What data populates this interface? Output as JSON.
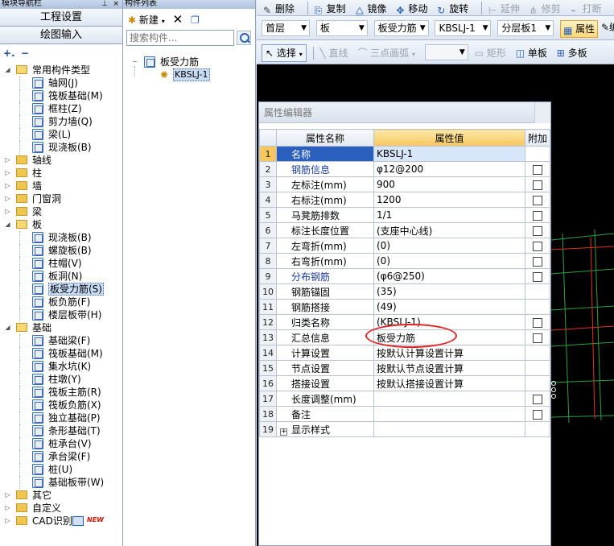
{
  "nav": {
    "title": "模块导航栏",
    "engineering_settings": "工程设置",
    "drawing_input": "绘图输入",
    "tree": [
      {
        "label": "常用构件类型",
        "level": 0,
        "open": true
      },
      {
        "label": "轴网(J)",
        "level": 1
      },
      {
        "label": "筏板基础(M)",
        "level": 1
      },
      {
        "label": "框柱(Z)",
        "level": 1
      },
      {
        "label": "剪力墙(Q)",
        "level": 1
      },
      {
        "label": "梁(L)",
        "level": 1
      },
      {
        "label": "现浇板(B)",
        "level": 1
      },
      {
        "label": "轴线",
        "level": 0
      },
      {
        "label": "柱",
        "level": 0
      },
      {
        "label": "墙",
        "level": 0
      },
      {
        "label": "门窗洞",
        "level": 0
      },
      {
        "label": "梁",
        "level": 0
      },
      {
        "label": "板",
        "level": 0,
        "open": true
      },
      {
        "label": "现浇板(B)",
        "level": 1
      },
      {
        "label": "螺旋板(B)",
        "level": 1
      },
      {
        "label": "柱帽(V)",
        "level": 1
      },
      {
        "label": "板洞(N)",
        "level": 1
      },
      {
        "label": "板受力筋(S)",
        "level": 1,
        "selected": true
      },
      {
        "label": "板负筋(F)",
        "level": 1
      },
      {
        "label": "楼层板带(H)",
        "level": 1
      },
      {
        "label": "基础",
        "level": 0,
        "open": true
      },
      {
        "label": "基础梁(F)",
        "level": 1
      },
      {
        "label": "筏板基础(M)",
        "level": 1
      },
      {
        "label": "集水坑(K)",
        "level": 1
      },
      {
        "label": "柱墩(Y)",
        "level": 1
      },
      {
        "label": "筏板主筋(R)",
        "level": 1
      },
      {
        "label": "筏板负筋(X)",
        "level": 1
      },
      {
        "label": "独立基础(P)",
        "level": 1
      },
      {
        "label": "条形基础(T)",
        "level": 1
      },
      {
        "label": "桩承台(V)",
        "level": 1
      },
      {
        "label": "承台梁(F)",
        "level": 1
      },
      {
        "label": "桩(U)",
        "level": 1
      },
      {
        "label": "基础板带(W)",
        "level": 1
      },
      {
        "label": "其它",
        "level": 0
      },
      {
        "label": "自定义",
        "level": 0
      },
      {
        "label": "CAD识别",
        "level": 0,
        "badge": "NEW"
      }
    ]
  },
  "list": {
    "title": "构件列表",
    "new_label": "新建",
    "search_placeholder": "搜索构件...",
    "group": "板受力筋",
    "item": "KBSLJ-1"
  },
  "toolbar1": {
    "delete": "删除",
    "copy": "复制",
    "mirror": "镜像",
    "move": "移动",
    "rotate": "旋转",
    "extend": "延伸",
    "trim": "修剪",
    "break": "打断"
  },
  "toolbar2": {
    "floor": "首层",
    "type": "板",
    "subtype": "板受力筋",
    "component": "KBSLJ-1",
    "layer": "分层板1",
    "property": "属性",
    "edit": "编"
  },
  "toolbar3": {
    "select": "选择",
    "line": "直线",
    "arc": "三点画弧",
    "rect": "矩形",
    "single_board": "单板",
    "multi_board": "多板"
  },
  "prop_editor": {
    "title": "属性编辑器",
    "col_name": "属性名称",
    "col_value": "属性值",
    "col_extra": "附加",
    "rows": [
      {
        "no": "1",
        "name": "名称",
        "value": "KBSLJ-1",
        "check": false
      },
      {
        "no": "2",
        "name": "钢筋信息",
        "value": "φ12@200",
        "check": true
      },
      {
        "no": "3",
        "name": "左标注(mm)",
        "value": "900",
        "check": true
      },
      {
        "no": "4",
        "name": "右标注(mm)",
        "value": "1200",
        "check": true
      },
      {
        "no": "5",
        "name": "马凳筋排数",
        "value": "1/1",
        "check": true
      },
      {
        "no": "6",
        "name": "标注长度位置",
        "value": "(支座中心线)",
        "check": true
      },
      {
        "no": "7",
        "name": "左弯折(mm)",
        "value": "(0)",
        "check": true
      },
      {
        "no": "8",
        "name": "右弯折(mm)",
        "value": "(0)",
        "check": true
      },
      {
        "no": "9",
        "name": "分布钢筋",
        "value": "(φ6@250)",
        "check": true
      },
      {
        "no": "10",
        "name": "钢筋锚固",
        "value": "(35)",
        "check": false
      },
      {
        "no": "11",
        "name": "钢筋搭接",
        "value": "(49)",
        "check": false
      },
      {
        "no": "12",
        "name": "归类名称",
        "value": "(KBSLJ-1)",
        "check": true
      },
      {
        "no": "13",
        "name": "汇总信息",
        "value": "板受力筋",
        "check": true
      },
      {
        "no": "14",
        "name": "计算设置",
        "value": "按默认计算设置计算",
        "check": false
      },
      {
        "no": "15",
        "name": "节点设置",
        "value": "按默认节点设置计算",
        "check": false
      },
      {
        "no": "16",
        "name": "搭接设置",
        "value": "按默认搭接设置计算",
        "check": false
      },
      {
        "no": "17",
        "name": "长度调整(mm)",
        "value": "",
        "check": true
      },
      {
        "no": "18",
        "name": "备注",
        "value": "",
        "check": true
      },
      {
        "no": "19",
        "name": "显示样式",
        "value": "",
        "check": false
      }
    ]
  }
}
